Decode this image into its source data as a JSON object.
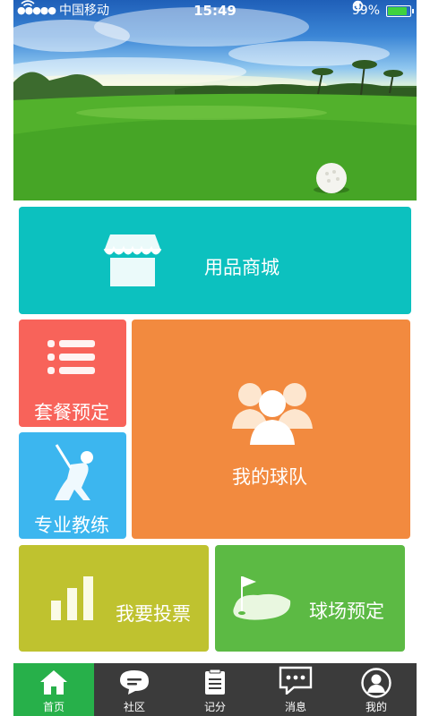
{
  "status_bar": {
    "carrier": "中国移动",
    "time": "15:49",
    "battery": "99%",
    "icons": [
      "signal-dots-icon",
      "wifi-icon",
      "rotation-lock-icon",
      "location-arrow-icon",
      "alarm-icon",
      "battery-icon"
    ]
  },
  "tiles": {
    "shop": {
      "label": "用品商城",
      "icon": "store-icon",
      "color": "#0cc1bf"
    },
    "package": {
      "label": "套餐预定",
      "icon": "list-icon",
      "color": "#f8635a"
    },
    "team": {
      "label": "我的球队",
      "icon": "group-icon",
      "color": "#f28a3f"
    },
    "coach": {
      "label": "专业教练",
      "icon": "golfer-icon",
      "color": "#3cb6ef"
    },
    "vote": {
      "label": "我要投票",
      "icon": "bar-chart-icon",
      "color": "#bfc22f"
    },
    "course": {
      "label": "球场预定",
      "icon": "golf-flag-icon",
      "color": "#5cba44"
    }
  },
  "tabbar": {
    "items": [
      {
        "label": "首页",
        "icon": "home-icon",
        "active": true
      },
      {
        "label": "社区",
        "icon": "chat-bubble-icon",
        "active": false
      },
      {
        "label": "记分",
        "icon": "clipboard-icon",
        "active": false
      },
      {
        "label": "消息",
        "icon": "message-icon",
        "active": false
      },
      {
        "label": "我的",
        "icon": "user-icon",
        "active": false
      }
    ],
    "active_color": "#27b04a",
    "background": "#3b3b3b"
  }
}
